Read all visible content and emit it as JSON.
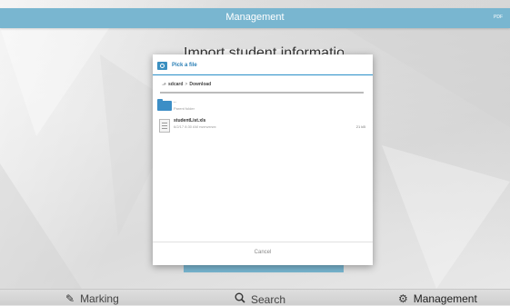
{
  "topbar": {
    "title": "Management",
    "pdf_label": "PDF"
  },
  "behind_card": {
    "heading": "Import student information"
  },
  "dialog": {
    "title": "Pick a file",
    "path": {
      "root": "sdcard",
      "separator": ">",
      "folder": "Download"
    },
    "parent": {
      "name": "..",
      "sub": "Parent folder"
    },
    "files": [
      {
        "name": "studentList.xls",
        "meta": "6/2/17 8:30 AM   rwxrwxrwx",
        "size": "21 kB"
      }
    ],
    "cancel_label": "Cancel"
  },
  "bottom_nav": {
    "items": [
      {
        "label": "Marking",
        "icon": "pencil-icon"
      },
      {
        "label": "Search",
        "icon": "search-icon"
      },
      {
        "label": "Management",
        "icon": "gear-icon"
      }
    ]
  },
  "colors": {
    "accent": "#79b6d0",
    "dialog_accent": "#2a7fb5",
    "folder": "#3c8ec6"
  }
}
